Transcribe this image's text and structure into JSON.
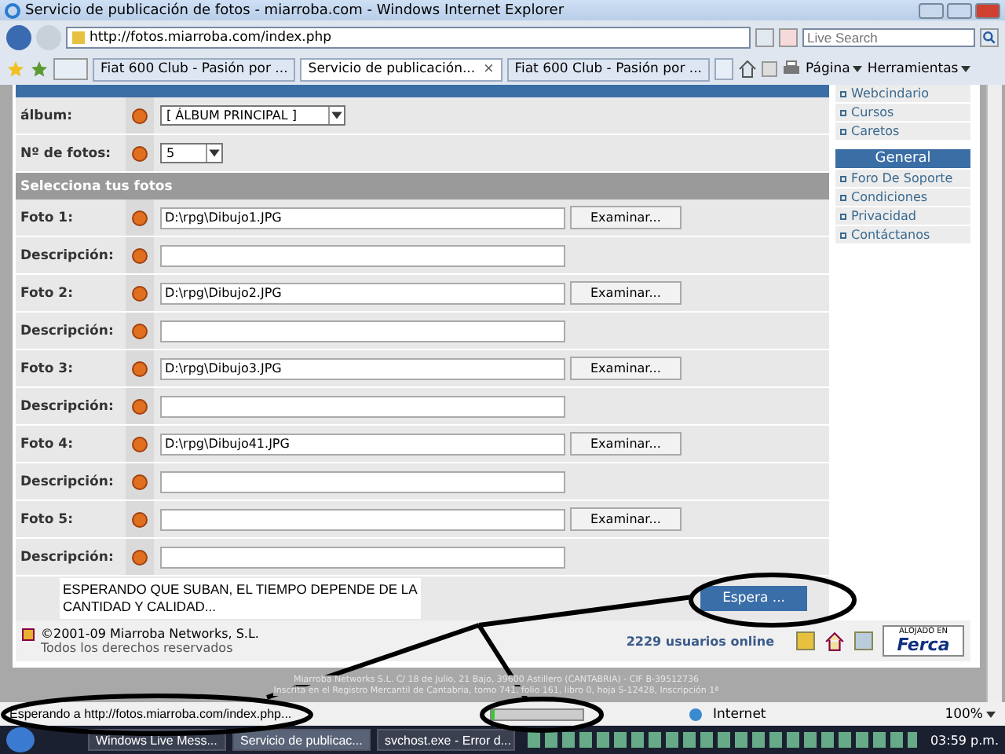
{
  "window": {
    "title": "Servicio de publicación de fotos - miarroba.com - Windows Internet Explorer"
  },
  "address_bar": {
    "url": "http://fotos.miarroba.com/index.php"
  },
  "search": {
    "placeholder": "Live Search"
  },
  "tabs": [
    {
      "label": "Fiat 600 Club - Pasión por ...",
      "selected": false
    },
    {
      "label": "Servicio de publicación...",
      "selected": true,
      "close": "×"
    },
    {
      "label": "Fiat 600 Club - Pasión por ...",
      "selected": false
    }
  ],
  "toolbar": {
    "page_menu": "Página",
    "tools_menu": "Herramientas"
  },
  "form": {
    "rows": [
      {
        "kind": "select",
        "label": "álbum:",
        "value": "[ ÁLBUM PRINCIPAL ]"
      },
      {
        "kind": "select",
        "label": "Nº de fotos:",
        "value": "5"
      },
      {
        "kind": "header",
        "label": "Selecciona tus fotos"
      },
      {
        "kind": "file",
        "label": "Foto 1:",
        "value": "D:\\rpg\\Dibujo1.JPG",
        "button": "Examinar..."
      },
      {
        "kind": "text",
        "label": "Descripción:"
      },
      {
        "kind": "file",
        "label": "Foto 2:",
        "value": "D:\\rpg\\Dibujo2.JPG",
        "button": "Examinar..."
      },
      {
        "kind": "text",
        "label": "Descripción:"
      },
      {
        "kind": "file",
        "label": "Foto 3:",
        "value": "D:\\rpg\\Dibujo3.JPG",
        "button": "Examinar..."
      },
      {
        "kind": "text",
        "label": "Descripción:"
      },
      {
        "kind": "file",
        "label": "Foto 4:",
        "value": "D:\\rpg\\Dibujo41.JPG",
        "button": "Examinar..."
      },
      {
        "kind": "text",
        "label": "Descripción:"
      },
      {
        "kind": "file",
        "label": "Foto 5:",
        "value": "",
        "button": "Examinar..."
      },
      {
        "kind": "text",
        "label": "Descripción:"
      }
    ],
    "note": "ESPERANDO QUE SUBAN, EL TIEMPO DEPENDE DE LA CANTIDAD Y CALIDAD...",
    "submit": "Espera ..."
  },
  "footer": {
    "copyright": "©2001-09 Miarroba Networks, S.L.",
    "rights": "Todos los derechos reservados",
    "users_online": "2229 usuarios online",
    "host_badge_top": "ALOJADO EN",
    "host_badge_name": "Ferca"
  },
  "legal": [
    "Miarroba Networks S.L. C/ 18 de Julio, 21 Bajo, 39600 Astillero (CANTABRIA) - CIF B-39512736",
    "Inscrita en el Registro Mercantil de Cantabria, tomo 741, folio 161, libro 0, hoja S-12428, Inscripción 1ª"
  ],
  "sidebar": {
    "links_top": [
      "Webcindario",
      "Cursos",
      "Caretos"
    ],
    "section": "General",
    "links": [
      "Foro De Soporte",
      "Condiciones",
      "Privacidad",
      "Contáctanos"
    ]
  },
  "status_bar": {
    "text": "Esperando a http://fotos.miarroba.com/index.php...",
    "level": 0.04,
    "zone": "Internet",
    "zoom": "100%"
  },
  "taskbar": {
    "tasks": [
      {
        "label": "Windows Live Mess...",
        "selected": false
      },
      {
        "label": "Servicio de publicac...",
        "selected": true
      },
      {
        "label": "svchost.exe - Error d...",
        "selected": false
      }
    ],
    "clock": "03:59 p.m."
  }
}
